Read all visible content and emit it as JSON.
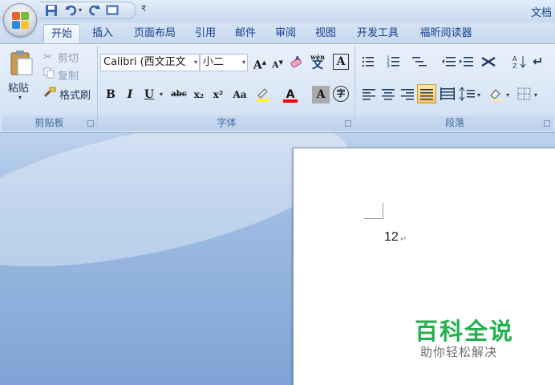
{
  "window": {
    "title": "文档"
  },
  "tabs": [
    "开始",
    "插入",
    "页面布局",
    "引用",
    "邮件",
    "审阅",
    "视图",
    "开发工具",
    "福昕阅读器"
  ],
  "clipboard": {
    "paste_label": "粘贴",
    "cut_label": "剪切",
    "copy_label": "复制",
    "format_painter_label": "格式刷",
    "group_label": "剪贴板"
  },
  "font": {
    "font_name": "Calibri (西文正文",
    "font_size": "小二",
    "group_label": "字体",
    "bold": "B",
    "italic": "I",
    "underline": "U",
    "strike": "abc",
    "subscript": "x₂",
    "superscript": "x²",
    "change_case": "Aa",
    "grow": "A",
    "shrink": "A",
    "char_border": "A",
    "char_shading": "A",
    "enclose": "字",
    "phonetic": "wén"
  },
  "paragraph": {
    "group_label": "段落"
  },
  "document": {
    "text": "12"
  },
  "watermark": {
    "title": "百科全说",
    "subtitle": "助你轻松解决"
  },
  "colors": {
    "ribbon_text": "#15428b",
    "watermark_green": "#22b14c",
    "highlight": "#ffff00",
    "font_color": "#ff0000"
  }
}
